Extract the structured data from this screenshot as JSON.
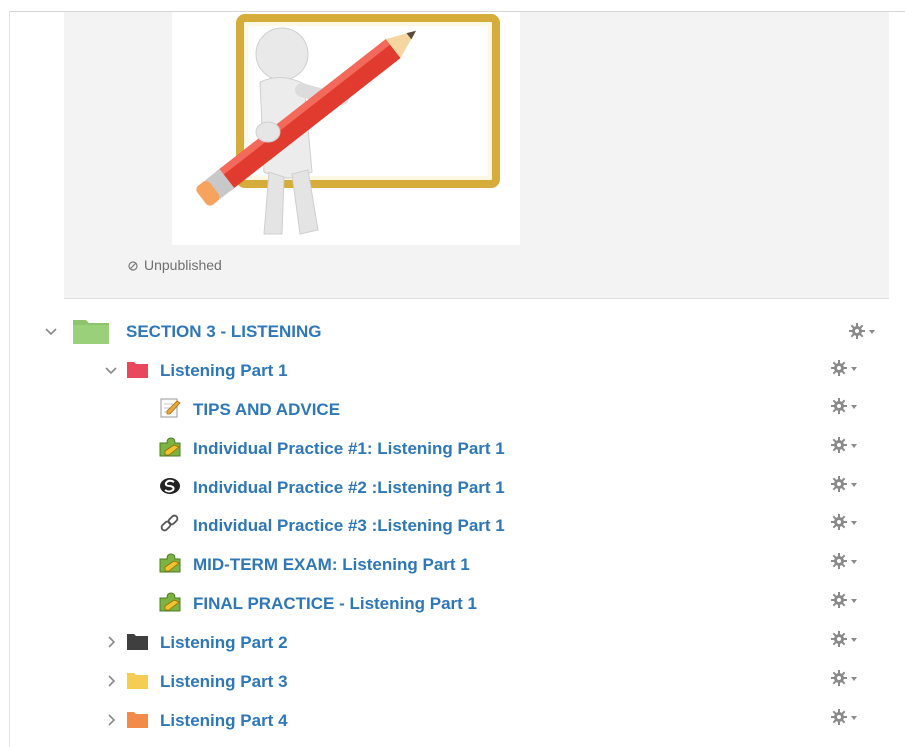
{
  "content_panel": {
    "status_text": "Unpublished"
  },
  "section": {
    "title": "SECTION 3 - LISTENING",
    "folder_color": "#9ad07a",
    "expanded": true
  },
  "subfolders": [
    {
      "title": "Listening Part 1",
      "color": "#e8475c",
      "expanded": true
    },
    {
      "title": "Listening Part 2",
      "color": "#3f3f3f",
      "expanded": false
    },
    {
      "title": "Listening Part 3",
      "color": "#f4cd52",
      "expanded": false
    },
    {
      "title": "Listening Part 4",
      "color": "#f28a4a",
      "expanded": false
    }
  ],
  "part1_items": [
    {
      "title": "TIPS AND ADVICE",
      "icon": "page-icon"
    },
    {
      "title": "Individual Practice #1: Listening Part 1",
      "icon": "quiz-puzzle-icon"
    },
    {
      "title": "Individual Practice #2 :Listening Part 1",
      "icon": "external-tool-icon"
    },
    {
      "title": "Individual Practice #3 :Listening Part 1",
      "icon": "link-icon"
    },
    {
      "title": "MID-TERM EXAM: Listening Part 1",
      "icon": "quiz-puzzle-icon"
    },
    {
      "title": "FINAL PRACTICE - Listening Part 1",
      "icon": "quiz-puzzle-icon"
    }
  ],
  "colors": {
    "link": "#2e77b8",
    "gear": "#8a8a8a",
    "chevron": "#8a8a8a"
  }
}
